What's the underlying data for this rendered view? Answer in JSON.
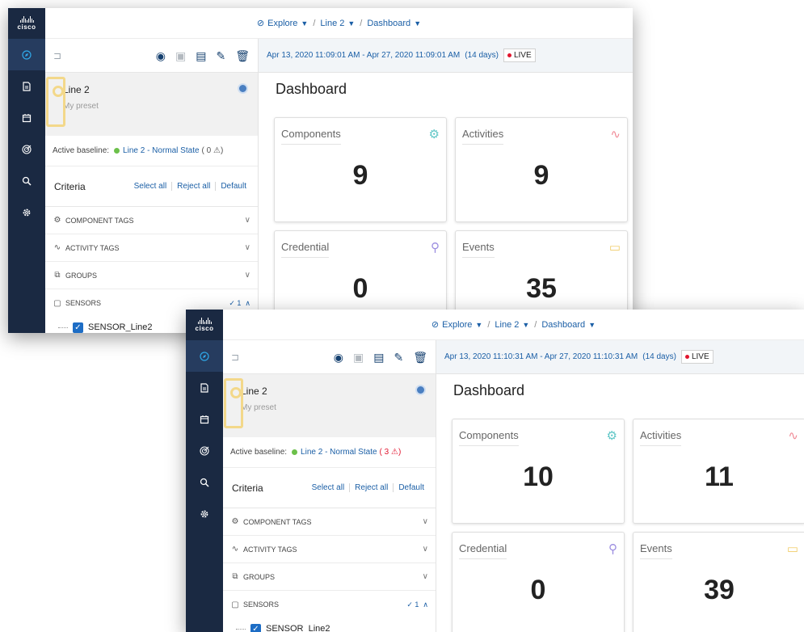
{
  "brand": {
    "logo_text": "cisco"
  },
  "nav_icons": [
    "explore-icon",
    "report-icon",
    "calendar-icon",
    "radar-icon",
    "search-icon",
    "settings-icon"
  ],
  "colors": {
    "rail": "#1a2942",
    "link": "#1b5fa6",
    "live_dot": "#e1152e",
    "baseline_dot": "#6cc04a",
    "pin": "#f3d88a"
  },
  "back": {
    "breadcrumb": {
      "explore": "Explore",
      "line": "Line 2",
      "page": "Dashboard",
      "sep1": "/",
      "sep2": "/"
    },
    "date_range": "Apr 13, 2020 11:09:01 AM - Apr 27, 2020 11:09:01 AM",
    "duration": "(14 days)",
    "live_label": "LIVE",
    "preset": {
      "title": "Line 2",
      "subtitle": "My preset"
    },
    "baseline": {
      "label": "Active baseline:",
      "name": "Line 2 - Normal State",
      "count": "( 0 ⚠)"
    },
    "criteria": {
      "label": "Criteria",
      "select_all": "Select all",
      "reject_all": "Reject all",
      "default": "Default"
    },
    "sections": {
      "component_tags": "COMPONENT TAGS",
      "activity_tags": "ACTIVITY TAGS",
      "groups": "GROUPS",
      "sensors": "SENSORS",
      "sensors_checked": "✓ 1"
    },
    "sensor_item": "SENSOR_Line2",
    "dashboard_title": "Dashboard",
    "cards": {
      "components": {
        "label": "Components",
        "value": "9"
      },
      "activities": {
        "label": "Activities",
        "value": "9"
      },
      "credential": {
        "label": "Credential",
        "value": "0"
      },
      "events": {
        "label": "Events",
        "value": "35"
      }
    }
  },
  "front": {
    "breadcrumb": {
      "explore": "Explore",
      "line": "Line 2",
      "page": "Dashboard",
      "sep1": "/",
      "sep2": "/"
    },
    "date_range": "Apr 13, 2020 11:10:31 AM - Apr 27, 2020 11:10:31 AM",
    "duration": "(14 days)",
    "live_label": "LIVE",
    "preset": {
      "title": "Line 2",
      "subtitle": "My preset"
    },
    "baseline": {
      "label": "Active baseline:",
      "name": "Line 2 - Normal State",
      "count": "( 3 ⚠)"
    },
    "criteria": {
      "label": "Criteria",
      "select_all": "Select all",
      "reject_all": "Reject all",
      "default": "Default"
    },
    "sections": {
      "component_tags": "COMPONENT TAGS",
      "activity_tags": "ACTIVITY TAGS",
      "groups": "GROUPS",
      "sensors": "SENSORS",
      "sensors_checked": "✓ 1"
    },
    "sensor_item": "SENSOR_Line2",
    "dashboard_title": "Dashboard",
    "cards": {
      "components": {
        "label": "Components",
        "value": "10"
      },
      "activities": {
        "label": "Activities",
        "value": "11"
      },
      "credential": {
        "label": "Credential",
        "value": "0"
      },
      "events": {
        "label": "Events",
        "value": "39"
      }
    }
  }
}
